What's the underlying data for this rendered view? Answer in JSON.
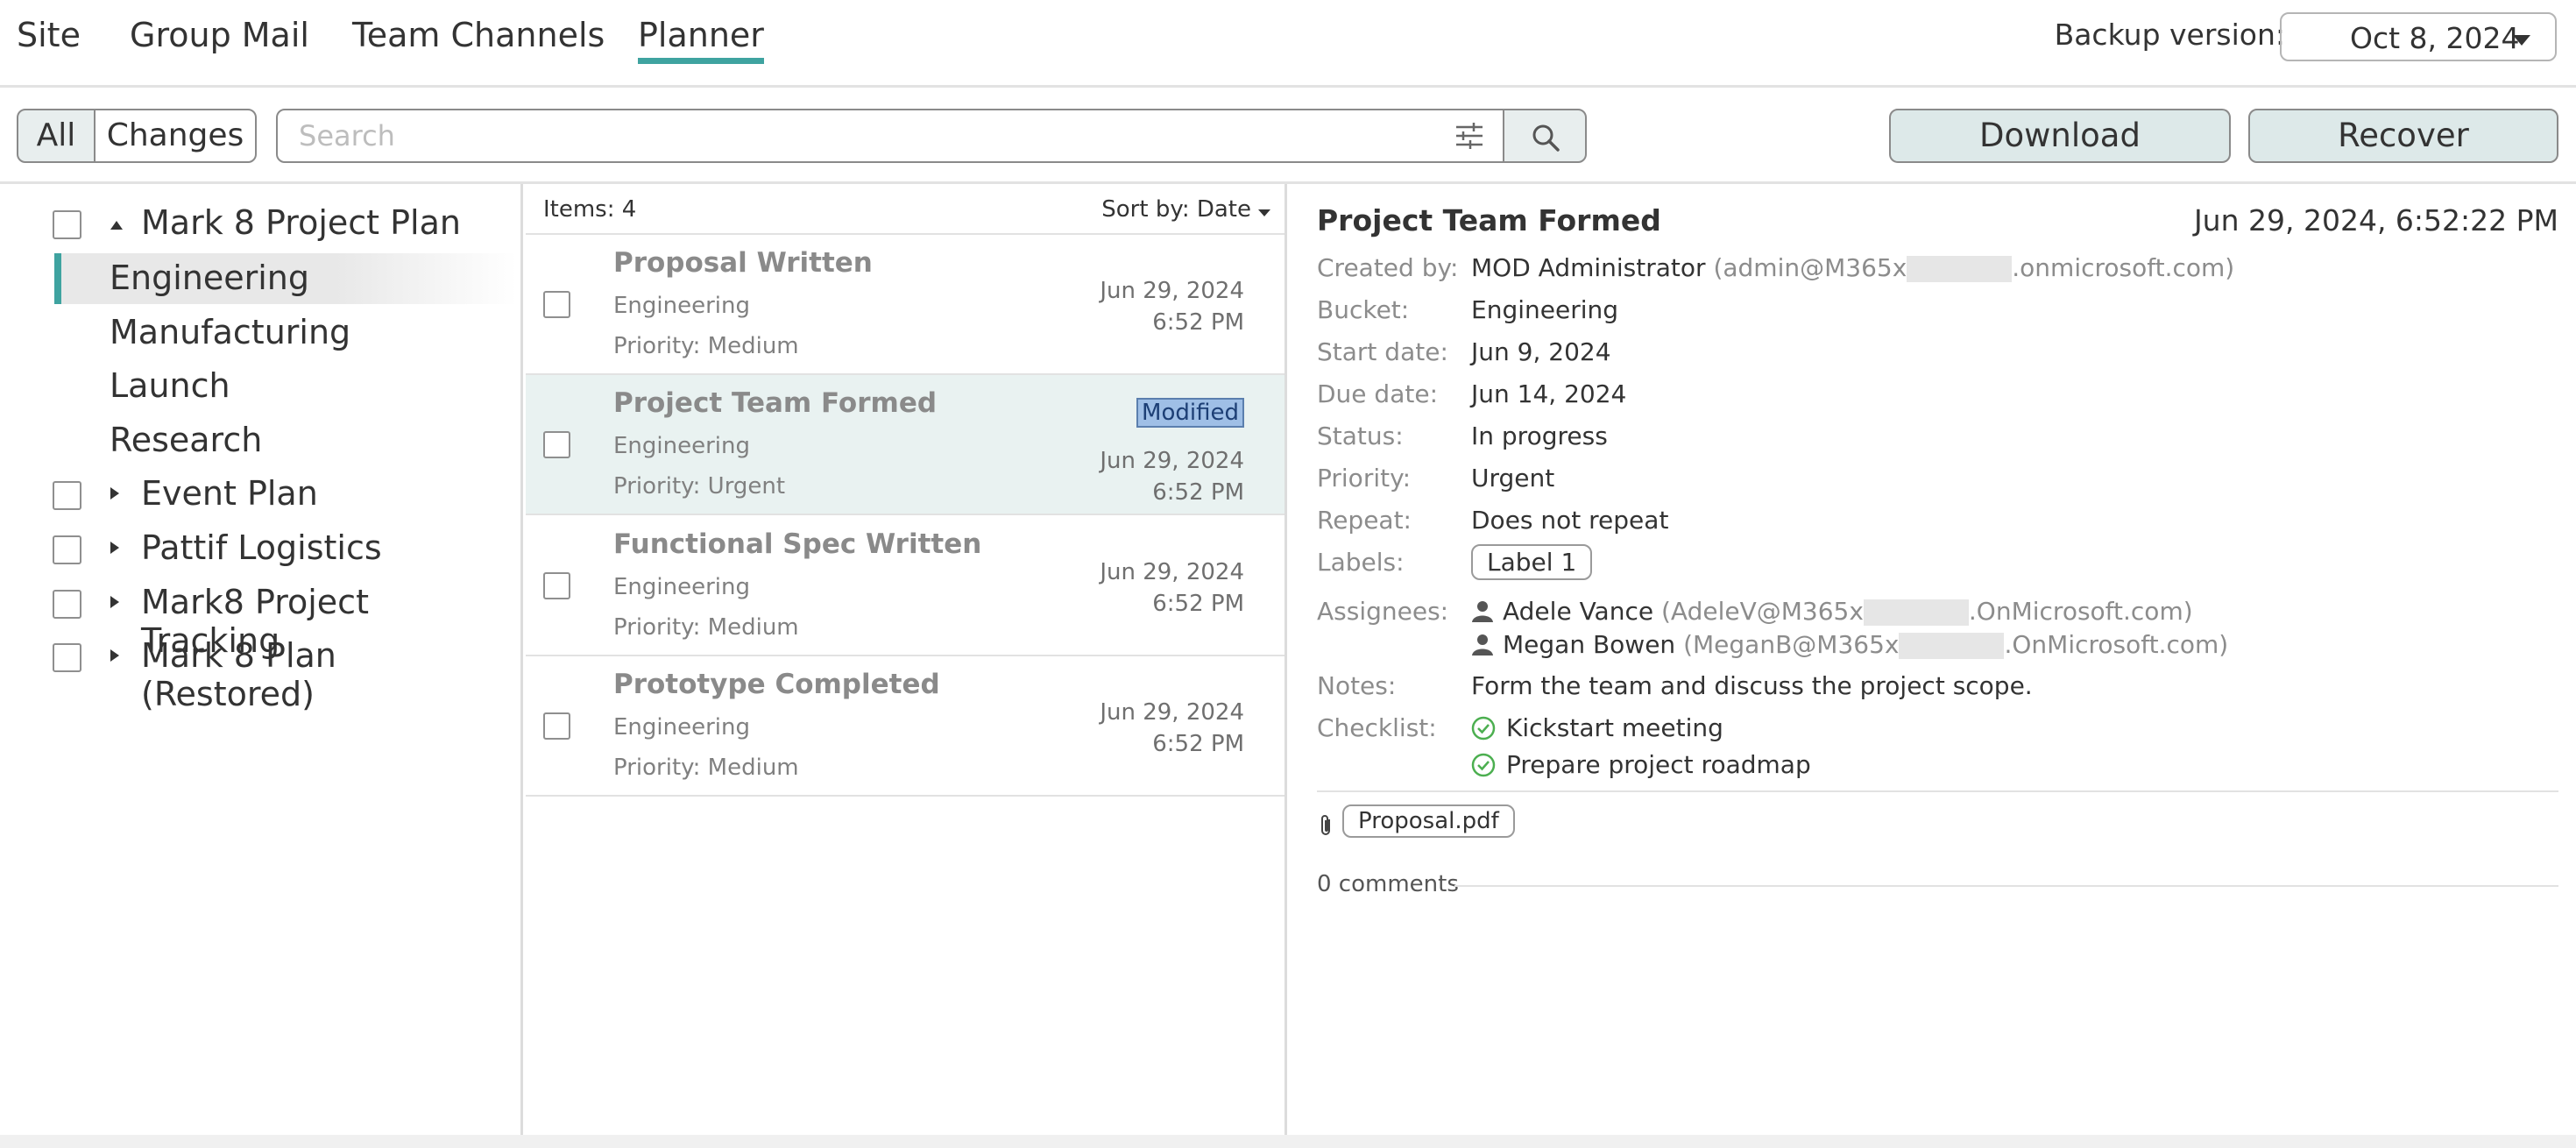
{
  "nav": {
    "tabs": [
      "Site",
      "Group Mail",
      "Team Channels",
      "Planner"
    ],
    "active_tab": "Planner",
    "backup_label": "Backup version:",
    "backup_value": "Oct 8, 2024"
  },
  "toolbar": {
    "all_label": "All",
    "changes_label": "Changes",
    "search_placeholder": "Search",
    "download_label": "Download",
    "recover_label": "Recover"
  },
  "tree": {
    "plans": [
      {
        "label": "Mark 8 Project Plan",
        "expanded": true
      },
      {
        "label": "Event Plan",
        "expanded": false
      },
      {
        "label": "Pattif Logistics",
        "expanded": false
      },
      {
        "label": "Mark8 Project Tracking",
        "expanded": false
      },
      {
        "label": "Mark 8 Plan (Restored)",
        "expanded": false
      }
    ],
    "buckets": [
      "Engineering",
      "Manufacturing",
      "Launch",
      "Research"
    ],
    "selected_bucket": "Engineering"
  },
  "list": {
    "items_count": "Items: 4",
    "sort_label": "Sort by: Date",
    "items": [
      {
        "title": "Proposal Written",
        "bucket": "Engineering",
        "priority": "Priority: Medium",
        "date": "Jun 29, 2024",
        "time": "6:52 PM",
        "badge": ""
      },
      {
        "title": "Project Team Formed",
        "bucket": "Engineering",
        "priority": "Priority: Urgent",
        "date": "Jun 29, 2024",
        "time": "6:52 PM",
        "badge": "Modified"
      },
      {
        "title": "Functional Spec Written",
        "bucket": "Engineering",
        "priority": "Priority: Medium",
        "date": "Jun 29, 2024",
        "time": "6:52 PM",
        "badge": ""
      },
      {
        "title": "Prototype Completed",
        "bucket": "Engineering",
        "priority": "Priority: Medium",
        "date": "Jun 29, 2024",
        "time": "6:52 PM",
        "badge": ""
      }
    ]
  },
  "detail": {
    "title": "Project Team Formed",
    "timestamp": "Jun 29, 2024, 6:52:22 PM",
    "created_by_key": "Created by:",
    "created_by_name": "MOD Administrator",
    "created_by_email_prefix": "(admin@M365x",
    "created_by_email_suffix": ".onmicrosoft.com)",
    "bucket_key": "Bucket:",
    "bucket": "Engineering",
    "start_key": "Start date:",
    "start": "Jun 9, 2024",
    "due_key": "Due date:",
    "due": "Jun 14, 2024",
    "status_key": "Status:",
    "status": "In progress",
    "priority_key": "Priority:",
    "priority": "Urgent",
    "repeat_key": "Repeat:",
    "repeat": "Does not repeat",
    "labels_key": "Labels:",
    "label": "Label 1",
    "assignees_key": "Assignees:",
    "assignees": [
      {
        "name": "Adele Vance",
        "email_prefix": "(AdeleV@M365x",
        "email_suffix": ".OnMicrosoft.com)"
      },
      {
        "name": "Megan Bowen",
        "email_prefix": "(MeganB@M365x",
        "email_suffix": ".OnMicrosoft.com)"
      }
    ],
    "notes_key": "Notes:",
    "notes": "Form the team and discuss the project scope.",
    "checklist_key": "Checklist:",
    "checklist": [
      "Kickstart meeting",
      "Prepare project roadmap"
    ],
    "attachment": "Proposal.pdf",
    "comments": "0 comments"
  },
  "colors": {
    "accent": "#3fa3a0",
    "selected_row": "#e9f2f1",
    "badge_bg": "#9fbfe6",
    "check_green": "#4caf50"
  },
  "icons": [
    "filter-icon",
    "search-icon",
    "caret-down-icon",
    "person-icon",
    "check-circle-icon",
    "paperclip-icon"
  ]
}
